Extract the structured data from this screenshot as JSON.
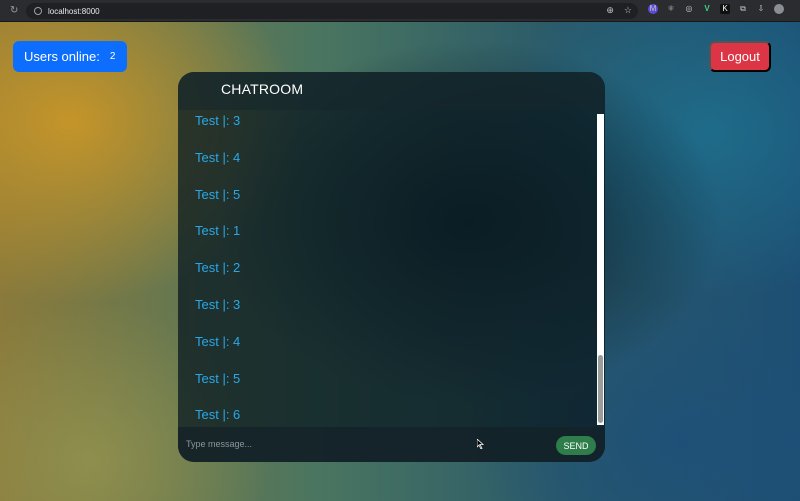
{
  "browser": {
    "url": "localhost:8000",
    "reload_icon": "↻",
    "zoom_icon": "⊕",
    "star_icon": "☆",
    "extensions": [
      "M",
      "⚛",
      "◎",
      "V",
      "K",
      "⧉",
      "⇩",
      "●"
    ]
  },
  "topbar": {
    "users_online_label": "Users online:",
    "users_online_count": "2",
    "logout_label": "Logout"
  },
  "chat": {
    "title": "CHATROOM",
    "messages": [
      "Test |: 3",
      "Test |: 4",
      "Test |: 5",
      "Test |: 1",
      "Test |: 2",
      "Test |: 3",
      "Test |: 4",
      "Test |: 5",
      "Test |: 6"
    ],
    "input_placeholder": "Type message...",
    "send_label": "SEND"
  },
  "colors": {
    "users_online_bg": "#0d6efd",
    "logout_bg": "#dc3545",
    "send_bg": "#2e7d4a",
    "message_text": "#29a8e8"
  }
}
